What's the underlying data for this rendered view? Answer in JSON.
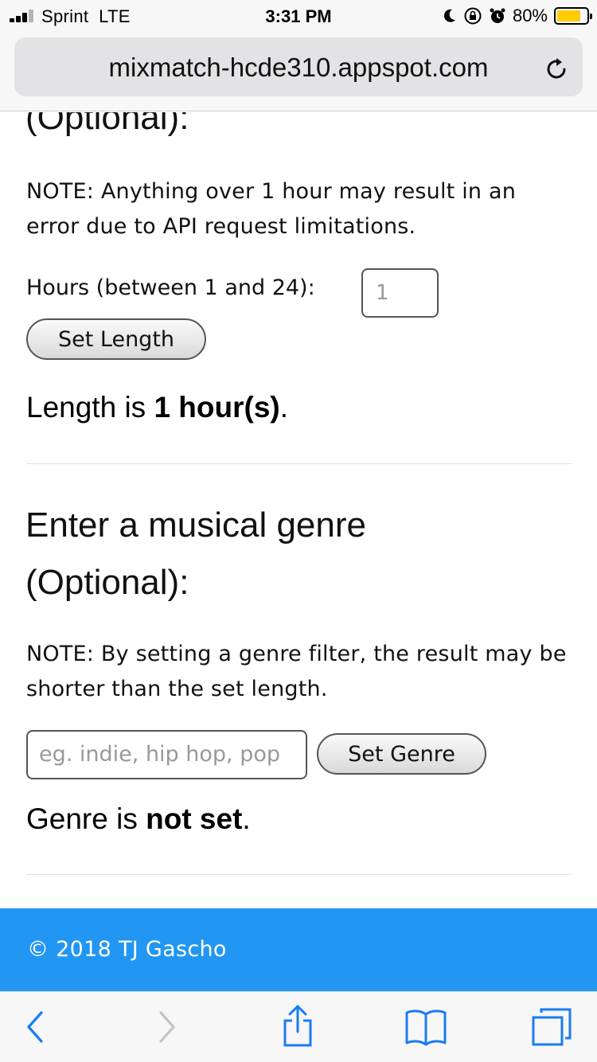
{
  "status_bar": {
    "carrier": "Sprint",
    "network": "LTE",
    "time": "3:31 PM",
    "battery_percent": "80%",
    "battery_level": 0.8,
    "battery_color": "#ffcc00"
  },
  "browser": {
    "url": "mixmatch-hcde310.appspot.com"
  },
  "length_section": {
    "heading_partial": "(Optional):",
    "note": "NOTE: Anything over 1 hour may result in an error due to API request limitations.",
    "hours_label": "Hours (between 1 and 24):",
    "hours_value": "1",
    "set_button": "Set Length",
    "status_prefix": "Length is ",
    "status_value": "1 hour(s)",
    "status_suffix": "."
  },
  "genre_section": {
    "heading_line1": "Enter a musical genre",
    "heading_line2": "(Optional):",
    "note": "NOTE: By setting a genre filter, the result may be shorter than the set length.",
    "input_placeholder": "eg. indie, hip hop, pop",
    "set_button": "Set Genre",
    "status_prefix": "Genre is ",
    "status_value": "not set",
    "status_suffix": "."
  },
  "footer": {
    "text": "© 2018 TJ Gascho",
    "background": "#2196f3"
  },
  "toolbar": {
    "icons": [
      "back-icon",
      "forward-icon",
      "share-icon",
      "bookmarks-icon",
      "tabs-icon"
    ],
    "accent": "#1a7cf5"
  }
}
